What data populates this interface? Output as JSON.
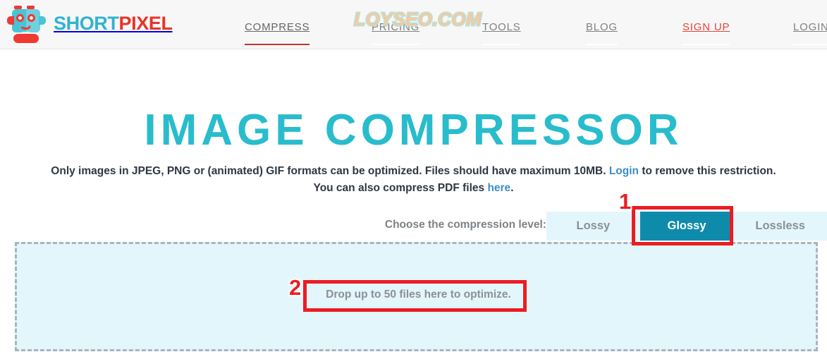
{
  "header": {
    "logo": {
      "icon": "shortpixel-robot-logo",
      "text_part1": "SHORT",
      "text_part2": "PIXEL"
    },
    "nav": [
      {
        "label": "COMPRESS",
        "active": true
      },
      {
        "label": "PRICING",
        "active": false
      },
      {
        "label": "TOOLS",
        "active": false
      },
      {
        "label": "BLOG",
        "active": false
      },
      {
        "label": "SIGN UP",
        "active": false
      },
      {
        "label": "LOGIN",
        "active": false
      }
    ]
  },
  "watermark": {
    "text": "LOYSEO.COM"
  },
  "main": {
    "page_title": "IMAGE COMPRESSOR",
    "intro": {
      "line1_before_link": "Only images in JPEG, PNG or (animated) GIF formats can be optimized. Files should have maximum 10MB. ",
      "line1_link": "Login",
      "line1_after_link": " to remove this restriction.",
      "line2_before_link": "You can also compress PDF files ",
      "line2_link": "here",
      "line2_after_link": "."
    },
    "compression": {
      "label": "Choose the compression level:",
      "options": [
        {
          "label": "Lossy",
          "selected": false
        },
        {
          "label": "Glossy",
          "selected": true
        },
        {
          "label": "Lossless",
          "selected": false
        }
      ],
      "selected_value": "Glossy"
    },
    "dropzone": {
      "text": "Drop up to 50 files here to optimize."
    }
  },
  "annotations": {
    "marker_1": "1",
    "marker_2": "2"
  },
  "colors": {
    "brand_teal": "#29bccd",
    "brand_red": "#e8342a",
    "selected_tab": "#0e8bab",
    "tab_bg": "#e3f6fc",
    "annotation_red": "#ec1c24",
    "link_blue": "#3b8ec9"
  }
}
